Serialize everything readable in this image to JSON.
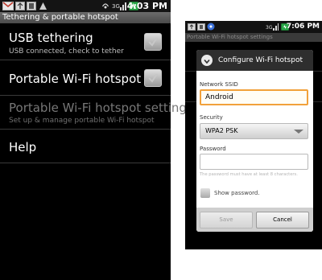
{
  "left_phone": {
    "status_bar": {
      "time": "4:03 PM",
      "icons": [
        "gmail-icon",
        "usb-icon",
        "sd-card-icon",
        "notification-icon",
        "hotspot-icon",
        "signal-icon",
        "battery-icon"
      ]
    },
    "title": "Tethering & portable hotspot",
    "rows": [
      {
        "label": "USB tethering",
        "summary": "USB connected, check to tether",
        "checked": false,
        "enabled": true
      },
      {
        "label": "Portable Wi-Fi hotspot",
        "checked": false,
        "enabled": true
      },
      {
        "label": "Portable Wi-Fi hotspot settings",
        "summary": "Set up & manage portable Wi-Fi hotspot",
        "enabled": false
      },
      {
        "label": "Help",
        "enabled": true
      }
    ]
  },
  "right_phone": {
    "status_bar": {
      "time": "7:06 PM",
      "icons": [
        "usb-icon",
        "sd-card-icon",
        "hotspot-icon",
        "signal-icon",
        "battery-icon"
      ]
    },
    "title": "Portable Wi-Fi hotspot settings",
    "dialog": {
      "title": "Configure Wi-Fi hotspot",
      "ssid_label": "Network SSID",
      "ssid_value": "Android",
      "security_label": "Security",
      "security_value": "WPA2 PSK",
      "password_label": "Password",
      "password_value": "",
      "password_hint": "The password must have at least 8 characters.",
      "show_password_label": "Show password.",
      "show_password_checked": false,
      "save_label": "Save",
      "cancel_label": "Cancel"
    }
  },
  "colors": {
    "focus_border": "#f1a13b",
    "title_bar": "#555555",
    "dialog_header": "#2e2e2e"
  }
}
